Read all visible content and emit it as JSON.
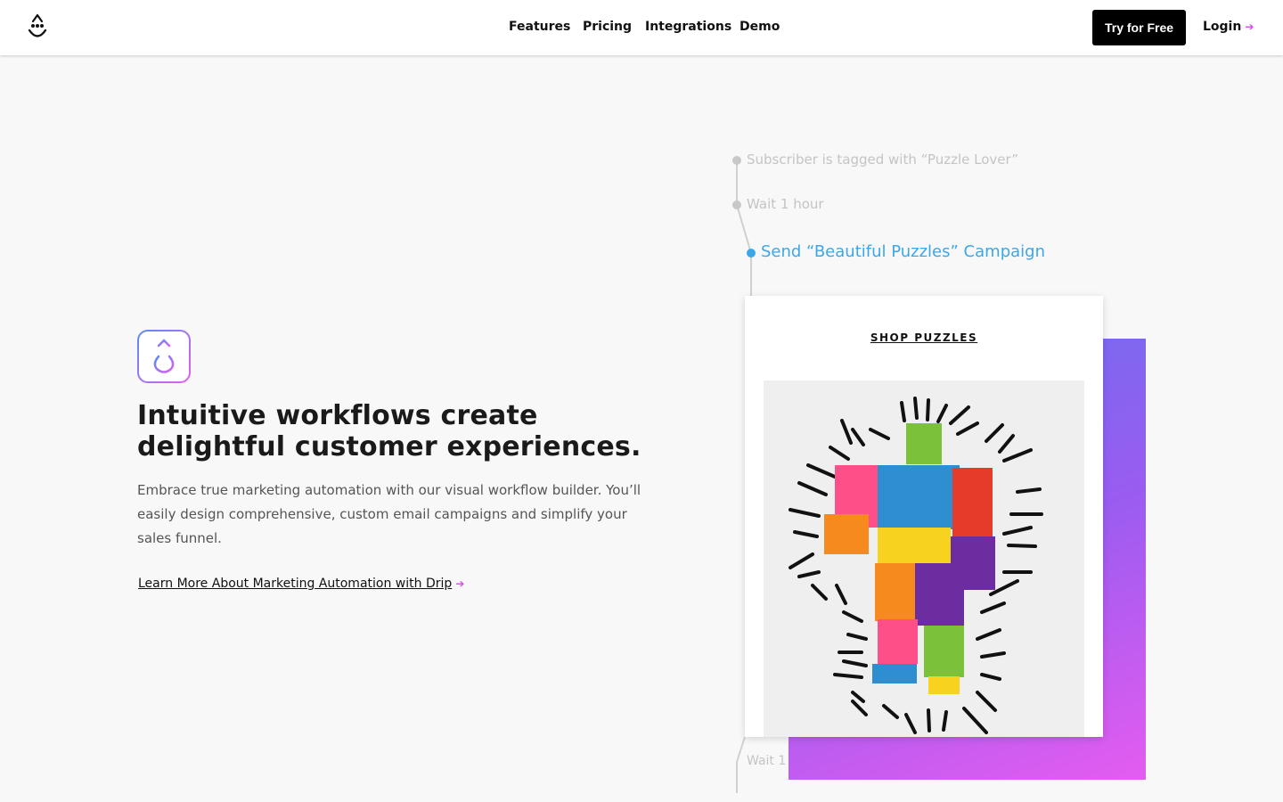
{
  "header": {
    "nav": [
      {
        "label": "Features"
      },
      {
        "label": "Pricing"
      },
      {
        "label": "Integrations"
      },
      {
        "label": "Demo"
      }
    ],
    "cta_label": "Try for Free",
    "login_label": "Login"
  },
  "hero": {
    "headline_line1": "Intuitive workflows create",
    "headline_line2": "delightful customer experiences.",
    "body": "Embrace true marketing automation with our visual workflow builder. You’ll easily design comprehensive, custom email campaigns and simplify your sales funnel.",
    "link_label": "Learn More About Marketing Automation with Drip"
  },
  "workflow": {
    "steps": [
      {
        "label": "Subscriber is tagged with “Puzzle Lover”"
      },
      {
        "label": "Wait 1 hour"
      },
      {
        "label": "Send “Beautiful Puzzles” Campaign"
      }
    ],
    "partial_step": "Wait 1"
  },
  "email": {
    "shop_label": "SHOP PUZZLES"
  },
  "colors": {
    "accent_blue": "#3ba7e8",
    "arrow_magenta": "#d946ef",
    "gradient_start": "#6a6ff0",
    "gradient_end": "#e45cf0"
  }
}
